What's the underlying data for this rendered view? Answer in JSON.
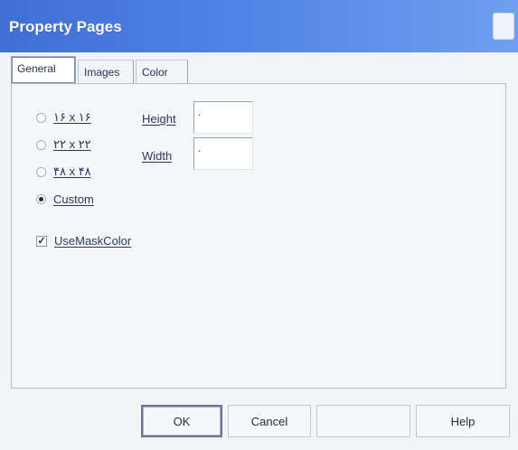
{
  "window": {
    "title": "Property Pages"
  },
  "tabs": [
    {
      "label": "General",
      "active": true
    },
    {
      "label": "Images",
      "active": false
    },
    {
      "label": "Color",
      "active": false
    }
  ],
  "size_options": [
    {
      "label": "۱۶ x ۱۶",
      "checked": false
    },
    {
      "label": "۲۲ x ۲۲",
      "checked": false
    },
    {
      "label": "۴۸ x ۴۸",
      "checked": false
    },
    {
      "label": "Custom",
      "checked": true
    }
  ],
  "fields": {
    "height": {
      "label": "Height",
      "value": "."
    },
    "width": {
      "label": "Width",
      "value": "."
    }
  },
  "mask": {
    "label": "UseMaskColor",
    "checked": true,
    "mark": "✓"
  },
  "buttons": {
    "ok": "OK",
    "cancel": "Cancel",
    "apply": "",
    "help": "Help"
  },
  "colors": {
    "title_bar": "#4f83e6",
    "background": "#f3f4f8"
  }
}
